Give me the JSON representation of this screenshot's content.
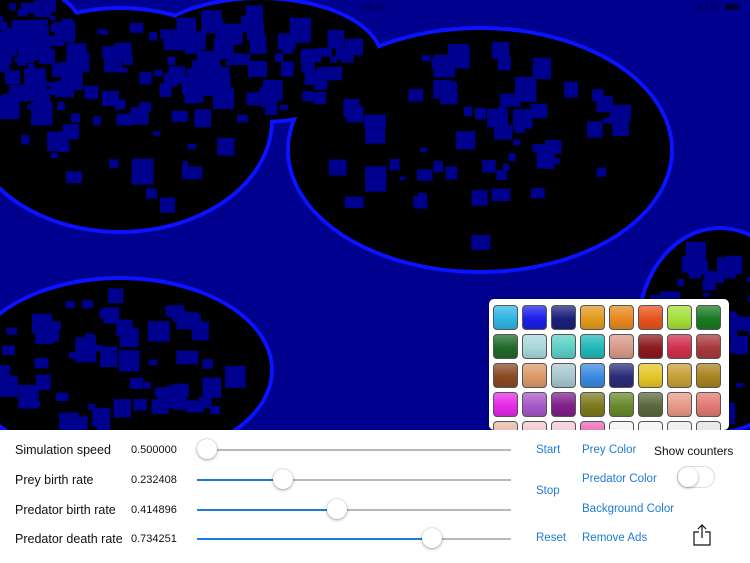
{
  "status_bar": {
    "time": "09:14",
    "battery": "87 %"
  },
  "simulation": {
    "colors": {
      "background": "#00008e",
      "prey": "#000000",
      "predator": "#0a12ff"
    }
  },
  "palette": {
    "rows": [
      [
        "#2fb6e3",
        "#1a1ee8",
        "#1c1f7a",
        "#e39a1e",
        "#e8891e",
        "#e8531e",
        "#a3e03a",
        "#1a7a22"
      ],
      [
        "#1f6a2a",
        "#a8d8dc",
        "#5cd0c6",
        "#22b8b8",
        "#d89a8a",
        "#8c1a1e",
        "#d0304e",
        "#a83a3e"
      ],
      [
        "#8a4a22",
        "#dc9a6a",
        "#a8c8d0",
        "#3a8ae0",
        "#2a2c7a",
        "#e6c626",
        "#c8a038",
        "#a8841e"
      ],
      [
        "#e62ae6",
        "#a858c8",
        "#80208a",
        "#7e7a1e",
        "#6a8a2e",
        "#5a6a3e",
        "#e89a88",
        "#e07a72"
      ],
      [
        "#e8b8a8",
        "#f2c8d0",
        "#f2cad6",
        "#ea6ab8",
        "#f4f4f4",
        "#f4f4f4",
        "#ececec",
        "#e4e4e4"
      ]
    ]
  },
  "controls": {
    "sliders": [
      {
        "label": "Simulation speed",
        "value_text": "0.500000",
        "position": 0.0,
        "filled": false
      },
      {
        "label": "Prey birth rate",
        "value_text": "0.232408",
        "position": 0.242,
        "filled": true
      },
      {
        "label": "Predator birth rate",
        "value_text": "0.414896",
        "position": 0.414,
        "filled": true
      },
      {
        "label": "Predator death rate",
        "value_text": "0.734251",
        "position": 0.717,
        "filled": true
      }
    ],
    "buttons": {
      "start": "Start",
      "stop": "Stop",
      "reset": "Reset"
    },
    "color_links": {
      "prey": "Prey Color",
      "predator": "Predator Color",
      "background": "Background Color",
      "remove_ads": "Remove Ads"
    },
    "show_counters": {
      "label": "Show counters",
      "on": false
    }
  }
}
